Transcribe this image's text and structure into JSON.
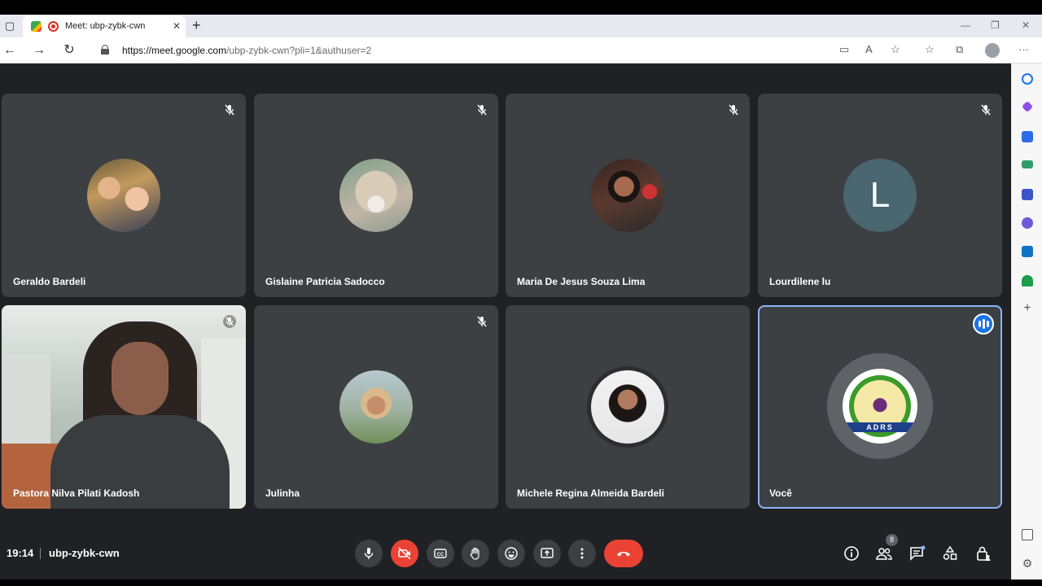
{
  "browser": {
    "tab_title": "Meet: ubp-zybk-cwn",
    "tab_close": "✕",
    "new_tab": "+",
    "url_domain": "https://meet.google.com",
    "url_path": "/ubp-zybk-cwn?pli=1&authuser=2"
  },
  "participants": [
    {
      "name": "Geraldo Bardeli",
      "muted": true
    },
    {
      "name": "Gislaine Patricia Sadocco",
      "muted": true
    },
    {
      "name": "Maria De Jesus Souza Lima",
      "muted": true
    },
    {
      "name": "Lourdilene lu",
      "muted": true,
      "avatar_letter": "L"
    },
    {
      "name": "Pastora Nilva Pilati Kadosh",
      "muted": true
    },
    {
      "name": "Julinha",
      "muted": true
    },
    {
      "name": "Michele Regina Almeida Bardeli",
      "muted": false
    },
    {
      "name": "Você",
      "muted": false,
      "speaking": true,
      "logo_text": "ADRS"
    }
  ],
  "bottombar": {
    "time": "19:14",
    "meeting_code": "ubp-zybk-cwn",
    "people_count": "8"
  },
  "colors": {
    "meet_bg": "#202124",
    "tile_bg": "#3c4043",
    "danger": "#ea4335",
    "speaking_border": "#8ab4f8",
    "speaking_badge": "#1a73e8"
  }
}
